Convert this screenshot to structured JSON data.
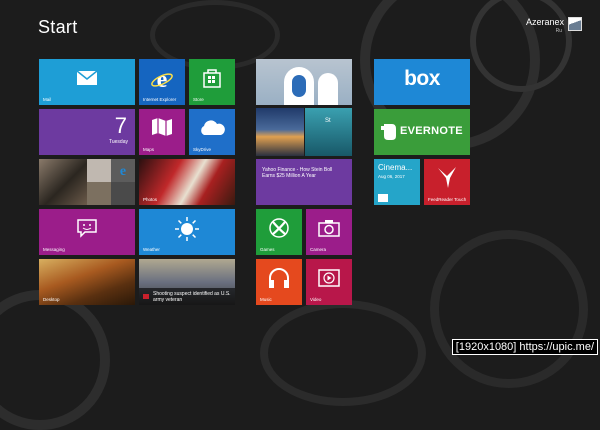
{
  "screen": {
    "title": "Start"
  },
  "user": {
    "name": "Azeranex",
    "sub": "Ru"
  },
  "tiles": {
    "mail": {
      "label": "Mail",
      "color": "#1e9ed6"
    },
    "ie": {
      "label": "Internet Explorer",
      "color": "#1565c0"
    },
    "store": {
      "label": "Store",
      "color": "#1f9d3a"
    },
    "calendar": {
      "label": "",
      "day": "7",
      "weekday": "Tuesday",
      "color": "#6d3aa0"
    },
    "maps": {
      "label": "Maps",
      "color": "#9b1d8a"
    },
    "skydrive": {
      "label": "SkyDrive",
      "color": "#1f6fc9"
    },
    "people": {
      "label": ""
    },
    "photos": {
      "label": "Photos"
    },
    "messaging": {
      "label": "Messaging",
      "color": "#9b1d8a"
    },
    "weather": {
      "label": "Weather",
      "color": "#1e88d6"
    },
    "desktop": {
      "label": "Desktop"
    },
    "news": {
      "label": "",
      "headline": "Shooting suspect identified as U.S. army veteran"
    },
    "travel": {
      "label": ""
    },
    "finance": {
      "label": "",
      "headline": "Yahoo Finance - How Stein Boll Earns $25 Million A Year",
      "color": "#6d3aa0"
    },
    "games": {
      "label": "Games",
      "color": "#1f9d3a"
    },
    "camera": {
      "label": "Camera",
      "color": "#9b1d8a"
    },
    "music": {
      "label": "Music",
      "color": "#e5491e"
    },
    "video": {
      "label": "Video",
      "color": "#b8174a"
    },
    "box": {
      "label": "box",
      "color": "#1e88d6"
    },
    "evernote": {
      "label": "EVERNOTE",
      "color": "#3a9d3a"
    },
    "cinema": {
      "label": "Cinema...",
      "sub": "Aug 06, 2017",
      "color": "#25a5c9"
    },
    "feedreader": {
      "label": "FeedReader Touch",
      "color": "#c8202c"
    }
  },
  "credit": {
    "text": "[1920x1080] https://upic.me/"
  }
}
